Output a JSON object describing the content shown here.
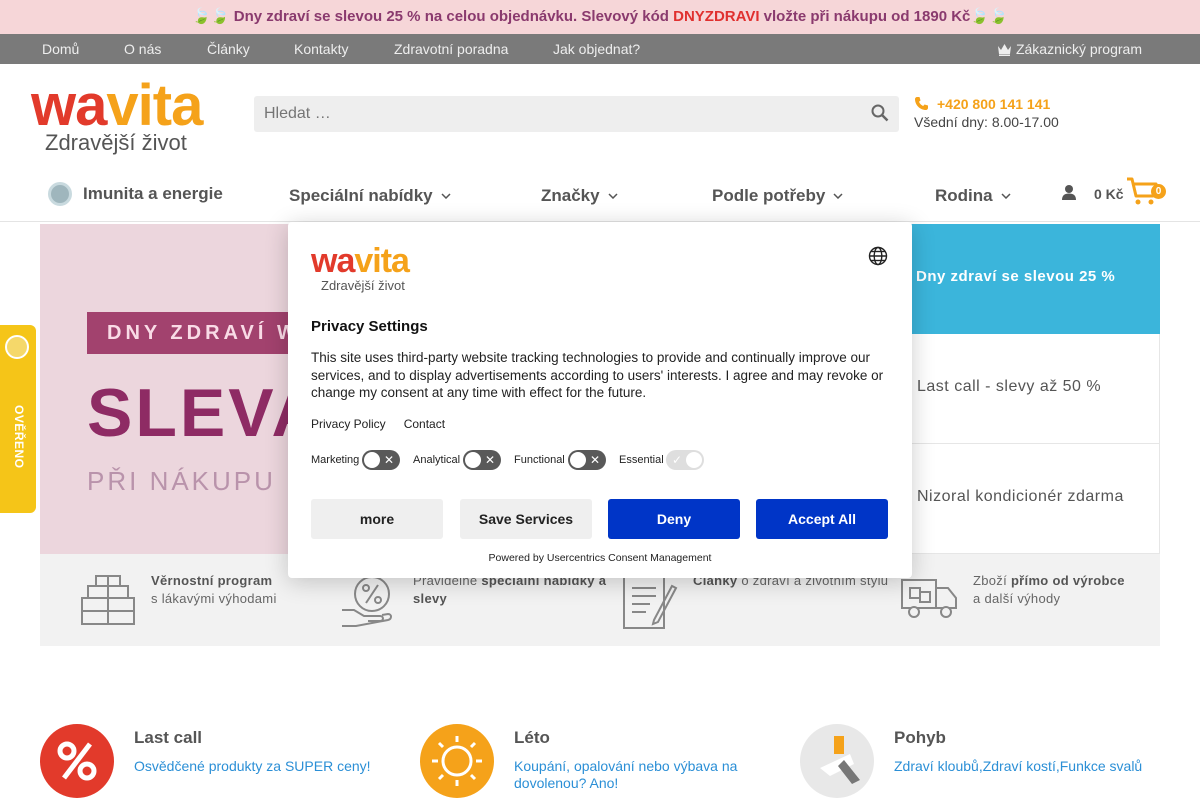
{
  "promo": {
    "before": "🍃🍃 Dny zdraví se slevou 25 % na celou objednávku. Slevový kód ",
    "code": "DNYZDRAVI",
    "after": " vložte při nákupu od 1890 Kč🍃🍃"
  },
  "topnav": {
    "items": [
      "Domů",
      "O nás",
      "Články",
      "Kontakty",
      "Zdravotní poradna",
      "Jak objednat?"
    ],
    "loyalty": "Zákaznický program"
  },
  "logo": {
    "word1": "wa",
    "word2": "vi",
    "word3": "ta",
    "tagline": "Zdravější život"
  },
  "search": {
    "placeholder": "Hledat …"
  },
  "contact": {
    "phone": "+420 800 141 141",
    "hours": "Všední dny: 8.00-17.00"
  },
  "mainnav": {
    "items": [
      "Imunita a energie",
      "Speciální nabídky",
      "Značky",
      "Podle potřeby",
      "Rodina"
    ],
    "cart_price": "0 Kč",
    "cart_count": "0"
  },
  "banner": {
    "tagline": "DNY ZDRAVÍ W",
    "big": "SLEVA",
    "sub": "PŘI NÁKUPU NA"
  },
  "side_list": {
    "active": "Dny zdraví se slevou 25 %",
    "items": [
      "Last call - slevy až 50 %",
      "Nizoral kondicionér zdarma"
    ]
  },
  "benefits": [
    {
      "bold": "Věrnostní program",
      "normal": "s lákavými výhodami"
    },
    {
      "normal": "Pravidelné ",
      "bold": "speciální nabídky a slevy"
    },
    {
      "bold": "Články",
      "normal": " o zdraví a životním stylu"
    },
    {
      "normal": "Zboží ",
      "bold": "přímo od výrobce",
      "normal2": "a další výhody"
    }
  ],
  "categories": [
    {
      "title": "Last call",
      "desc": "Osvědčené produkty za SUPER ceny!",
      "color": "#e23a2b"
    },
    {
      "title": "Léto",
      "desc": "Koupání, opalování nebo výbava na dovolenou? Ano!",
      "color": "#f5a21a"
    },
    {
      "title": "Pohyb",
      "desc": "Zdraví kloubů,Zdraví kostí,Funkce svalů",
      "color": "#e8e8e8"
    }
  ],
  "badge": {
    "text": "OVĚŘENO ZÁKAZNÍKY"
  },
  "consent": {
    "title": "Privacy Settings",
    "body": "This site uses third-party website tracking technologies to provide and continually improve our services, and to display advertisements according to users' interests. I agree and may revoke or change my consent at any time with effect for the future.",
    "links": [
      "Privacy Policy",
      "Contact"
    ],
    "toggles": [
      "Marketing",
      "Analytical",
      "Functional",
      "Essential"
    ],
    "buttons": {
      "more": "more",
      "save": "Save Services",
      "deny": "Deny",
      "accept": "Accept All"
    },
    "powered": "Powered by Usercentrics Consent Management"
  },
  "colors": {
    "accent_orange": "#f5a21a",
    "brand_red": "#e23a2b",
    "consent_blue": "#0035c7",
    "side_active": "#3bb5db"
  }
}
